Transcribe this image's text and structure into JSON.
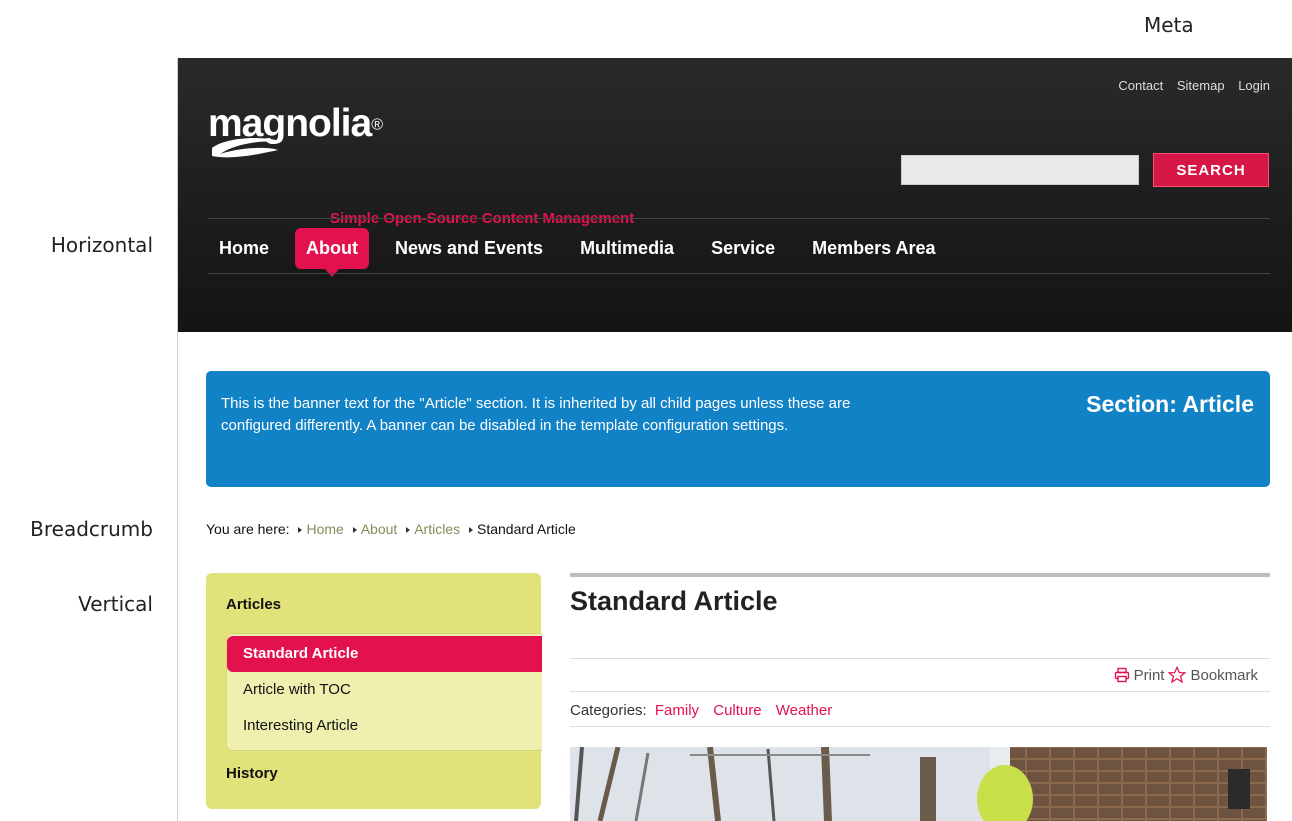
{
  "annotations": {
    "meta": "Meta",
    "horizontal": "Horizontal",
    "breadcrumb": "Breadcrumb",
    "vertical": "Vertical"
  },
  "header": {
    "logo_text": "magnolia",
    "logo_reg": "®",
    "tagline": "Simple Open-Source Content Management",
    "meta_links": [
      "Contact",
      "Sitemap",
      "Login"
    ],
    "search": {
      "value": "",
      "button": "SEARCH"
    },
    "nav": [
      "Home",
      "About",
      "News and Events",
      "Multimedia",
      "Service",
      "Members Area"
    ],
    "nav_active": "About"
  },
  "banner": {
    "text": "This is the banner text for the \"Article\" section. It is inherited by all child pages unless these are configured differently. A banner can be disabled in the template configuration settings.",
    "section": "Section: Article"
  },
  "breadcrumb": {
    "prefix": "You are here:",
    "links": [
      "Home",
      "About",
      "Articles"
    ],
    "current": "Standard Article"
  },
  "vertical_nav": {
    "heading": "Articles",
    "items": [
      "Standard Article",
      "Article with TOC",
      "Interesting Article"
    ],
    "active": "Standard Article",
    "footer_heading": "History"
  },
  "article": {
    "title": "Standard Article",
    "print": "Print",
    "bookmark": "Bookmark",
    "categories_label": "Categories:",
    "categories": [
      "Family",
      "Culture",
      "Weather"
    ]
  },
  "colors": {
    "accent": "#e3124f",
    "banner": "#1282c6",
    "vnav": "#e2e27a",
    "header": "#1a1a1a"
  }
}
